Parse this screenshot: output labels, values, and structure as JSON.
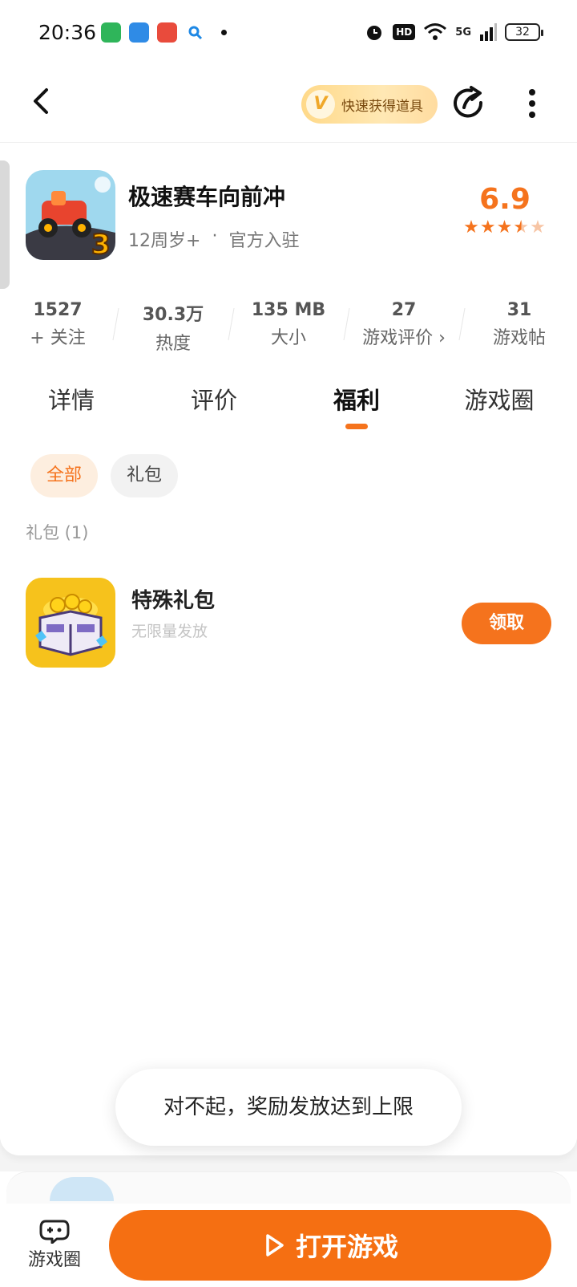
{
  "status_bar": {
    "time": "20:36",
    "network": "5G",
    "hd": "HD",
    "battery": "32"
  },
  "toolbar": {
    "quick_label": "快速获得道具",
    "v_badge": "V"
  },
  "game": {
    "title": "极速赛车向前冲",
    "age": "12周岁+",
    "separator": "·",
    "official": "官方入驻",
    "rating": "6.9",
    "stars_value": 3.5,
    "stars_max": 5
  },
  "stats": [
    {
      "value": "1527",
      "label": "+ 关注"
    },
    {
      "value": "30.3万",
      "label": "热度"
    },
    {
      "value": "135 MB",
      "label": "大小"
    },
    {
      "value": "27",
      "label": "游戏评价 ›"
    },
    {
      "value": "31",
      "label": "游戏帖"
    }
  ],
  "tabs": [
    "详情",
    "评价",
    "福利",
    "游戏圈"
  ],
  "active_tab": "福利",
  "chips": [
    "全部",
    "礼包"
  ],
  "section_label": "礼包 (1)",
  "gift": {
    "title": "特殊礼包",
    "subtitle": "无限量发放",
    "button": "领取"
  },
  "toast": "对不起，奖励发放达到上限",
  "bottom": {
    "circle_label": "游戏圈",
    "open_button": "打开游戏"
  },
  "colors": {
    "accent": "#f5731d",
    "button": "#f56f12"
  }
}
